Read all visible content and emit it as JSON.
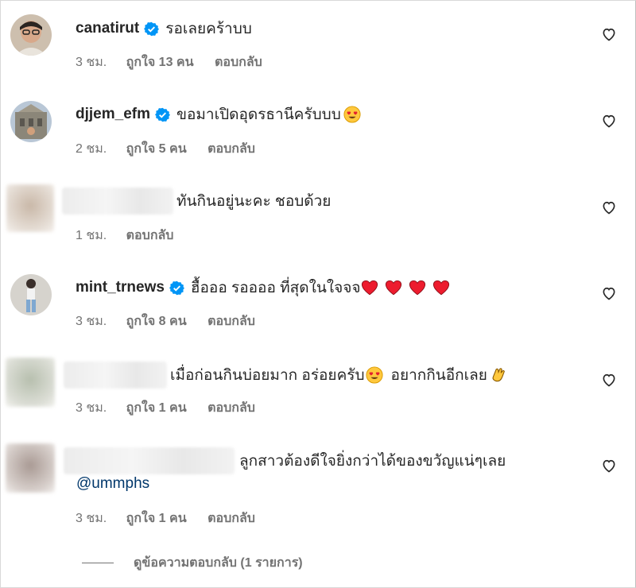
{
  "comments": [
    {
      "username": "canatirut",
      "verified": true,
      "text": "รอเลยคร้าบบ",
      "time": "3 ชม.",
      "likes": "ถูกใจ 13 คน",
      "reply": "ตอบกลับ"
    },
    {
      "username": "djjem_efm",
      "verified": true,
      "text": "ขอมาเปิดอุดรธานีครับบบ",
      "emoji": "heart-eyes",
      "time": "2 ชม.",
      "likes": "ถูกใจ 5 คน",
      "reply": "ตอบกลับ"
    },
    {
      "username": "",
      "verified": false,
      "text": "ทันกินอยู่นะคะ ชอบด้วย",
      "time": "1 ชม.",
      "reply": "ตอบกลับ"
    },
    {
      "username": "mint_trnews",
      "verified": true,
      "text": "ฮื้อออ รออออ ที่สุดในใจจจ",
      "emoji": "red-hearts-x4",
      "time": "3 ชม.",
      "likes": "ถูกใจ 8 คน",
      "reply": "ตอบกลับ"
    },
    {
      "username": "",
      "verified": false,
      "text_a": "เมื่อก่อนกินบ่อยมาก อร่อยครับ",
      "text_b": "อยากกินอีกเลย",
      "emoji": "heart-eyes, clapping-hands",
      "time": "3 ชม.",
      "likes": "ถูกใจ 1 คน",
      "reply": "ตอบกลับ"
    },
    {
      "username": "",
      "verified": false,
      "text": "ลูกสาวต้องดีใจยิ่งกว่าได้ของขวัญแน่ๆเลย",
      "mention": "@ummphs",
      "time": "3 ชม.",
      "likes": "ถูกใจ 1 คน",
      "reply": "ตอบกลับ"
    }
  ],
  "view_replies": "ดูข้อความตอบกลับ (1 รายการ)",
  "colors": {
    "text": "#262626",
    "secondary": "#737373",
    "verified": "#0095f6",
    "mention": "#00376b",
    "heart_red": "#ed1c2e"
  }
}
